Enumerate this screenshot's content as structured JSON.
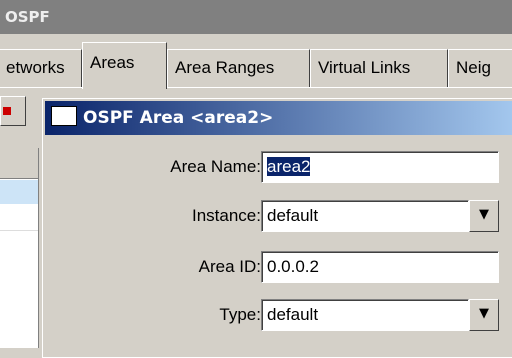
{
  "window": {
    "title": "OSPF"
  },
  "tabs": [
    {
      "label": "etworks"
    },
    {
      "label": "Areas"
    },
    {
      "label": "Area Ranges"
    },
    {
      "label": "Virtual Links"
    },
    {
      "label": "Neig"
    }
  ],
  "dialog": {
    "title": "OSPF Area <area2>",
    "fields": {
      "area_name": {
        "label": "Area Name:",
        "value": "area2"
      },
      "instance": {
        "label": "Instance:",
        "value": "default"
      },
      "area_id": {
        "label": "Area ID:",
        "value": "0.0.0.2"
      },
      "type": {
        "label": "Type:",
        "value": "default"
      }
    }
  },
  "icons": {
    "dropdown": "arrow-down-icon",
    "window": "window-icon"
  },
  "colors": {
    "title_active": "#0a246a",
    "title_inactive": "#808080",
    "selection": "#0a246a",
    "face": "#d4d0c8"
  }
}
